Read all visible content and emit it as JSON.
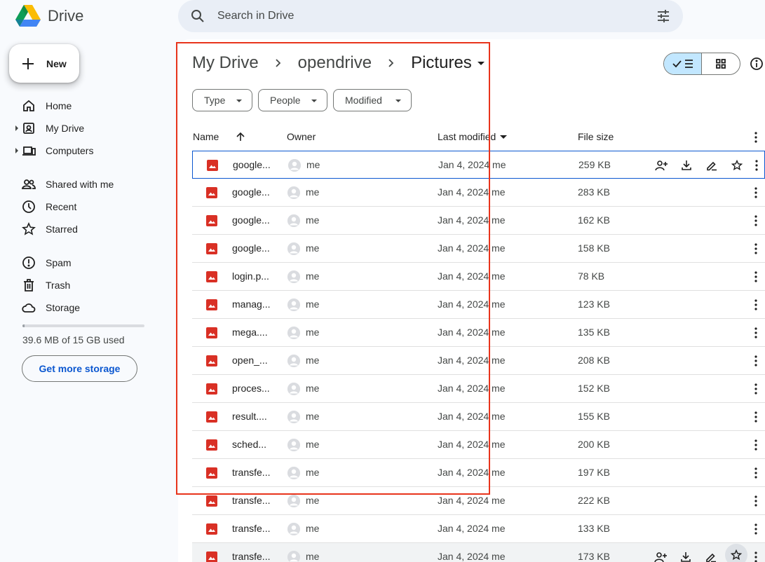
{
  "app": {
    "name": "Drive"
  },
  "search": {
    "placeholder": "Search in Drive"
  },
  "new_button": {
    "label": "New"
  },
  "sidebar": {
    "items": [
      {
        "label": "Home",
        "icon": "home-icon"
      },
      {
        "label": "My Drive",
        "icon": "my-drive-icon"
      },
      {
        "label": "Computers",
        "icon": "computers-icon"
      },
      {
        "label": "Shared with me",
        "icon": "shared-icon"
      },
      {
        "label": "Recent",
        "icon": "recent-icon"
      },
      {
        "label": "Starred",
        "icon": "star-icon"
      },
      {
        "label": "Spam",
        "icon": "spam-icon"
      },
      {
        "label": "Trash",
        "icon": "trash-icon"
      },
      {
        "label": "Storage",
        "icon": "cloud-icon"
      }
    ],
    "storage": {
      "used_text": "39.6 MB of 15 GB used",
      "used_fraction": 0.003,
      "cta": "Get more storage"
    }
  },
  "breadcrumb": {
    "items": [
      "My Drive",
      "opendrive",
      "Pictures"
    ]
  },
  "filters": [
    "Type",
    "People",
    "Modified"
  ],
  "columns": {
    "name": "Name",
    "owner": "Owner",
    "modified": "Last modified",
    "size": "File size"
  },
  "files": [
    {
      "name": "google...",
      "owner": "me",
      "modified": "Jan 4, 2024 me",
      "size": "259 KB"
    },
    {
      "name": "google...",
      "owner": "me",
      "modified": "Jan 4, 2024 me",
      "size": "283 KB"
    },
    {
      "name": "google...",
      "owner": "me",
      "modified": "Jan 4, 2024 me",
      "size": "162 KB"
    },
    {
      "name": "google...",
      "owner": "me",
      "modified": "Jan 4, 2024 me",
      "size": "158 KB"
    },
    {
      "name": "login.p...",
      "owner": "me",
      "modified": "Jan 4, 2024 me",
      "size": "78 KB"
    },
    {
      "name": "manag...",
      "owner": "me",
      "modified": "Jan 4, 2024 me",
      "size": "123 KB"
    },
    {
      "name": "mega....",
      "owner": "me",
      "modified": "Jan 4, 2024 me",
      "size": "135 KB"
    },
    {
      "name": "open_...",
      "owner": "me",
      "modified": "Jan 4, 2024 me",
      "size": "208 KB"
    },
    {
      "name": "proces...",
      "owner": "me",
      "modified": "Jan 4, 2024 me",
      "size": "152 KB"
    },
    {
      "name": "result....",
      "owner": "me",
      "modified": "Jan 4, 2024 me",
      "size": "155 KB"
    },
    {
      "name": "sched...",
      "owner": "me",
      "modified": "Jan 4, 2024 me",
      "size": "200 KB"
    },
    {
      "name": "transfe...",
      "owner": "me",
      "modified": "Jan 4, 2024 me",
      "size": "197 KB"
    },
    {
      "name": "transfe...",
      "owner": "me",
      "modified": "Jan 4, 2024 me",
      "size": "222 KB"
    },
    {
      "name": "transfe...",
      "owner": "me",
      "modified": "Jan 4, 2024 me",
      "size": "133 KB"
    },
    {
      "name": "transfe...",
      "owner": "me",
      "modified": "Jan 4, 2024 me",
      "size": "173 KB"
    }
  ],
  "row_actions": [
    "share-icon",
    "download-icon",
    "rename-icon",
    "star-icon"
  ],
  "colors": {
    "accent": "#0b57d0",
    "selected_view": "#c2e7ff",
    "image_file": "#d93025",
    "highlight_box": "#e8341c"
  }
}
